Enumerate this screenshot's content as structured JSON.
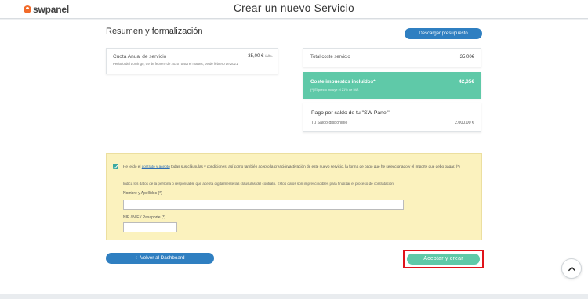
{
  "header": {
    "logo_text": "swpanel",
    "title": "Crear un nuevo Servicio"
  },
  "summary": {
    "title": "Resumen y formalización",
    "download_button": "Descargar presupuesto"
  },
  "quota": {
    "name": "Cuota Anual de servicio",
    "price": "35,00 €",
    "unit": "/año.",
    "period": "Periodo del domingo, 09 de febrero de 2020 hasta el martes, 09 de febrero de 2021"
  },
  "costs": {
    "total_label": "Total coste servicio",
    "total_value": "35,00€",
    "tax_label": "Coste impuestos incluidos*",
    "tax_value": "42,35€",
    "tax_note": "(*) El precio incluye el 21% de IVA."
  },
  "balance": {
    "title": "Pago por saldo de tu \"SW Panel\".",
    "label": "Tu Saldo disponible",
    "value": "2.000,00 €"
  },
  "terms": {
    "text_before": "He leído el ",
    "link": "contrato y acepto",
    "text_after": " todas sus cláusulas y condiciones, así como también acepto la creación/activación de este nuevo servicio, la forma de pago que he seleccionado y el importe que debo pagar.  (*)",
    "info": "Indica los datos de la persona o responsable que acepta digitalmente las cláusulas del contrato. Estos datos son imprescindibles para finalizar el proceso de contratación.",
    "name_label": "Nombre y Apellidos (*)",
    "name_value": "",
    "id_label": "NIF / NIE / Pasaporte (*)",
    "id_value": ""
  },
  "actions": {
    "back_label": "Volver al Dashboard",
    "accept_label": "Aceptar y crear"
  },
  "colors": {
    "brand_orange": "#f26b2a",
    "primary_blue": "#2f7fc1",
    "accent_green": "#5fc9a8",
    "terms_bg": "#fbf2be",
    "highlight_red": "#e0131a"
  },
  "icons": {
    "logo": "swpanel-logo-icon",
    "checkbox": "checkbox-checked-icon",
    "back": "chevron-left-icon",
    "scroll_top": "chevron-up-icon"
  }
}
